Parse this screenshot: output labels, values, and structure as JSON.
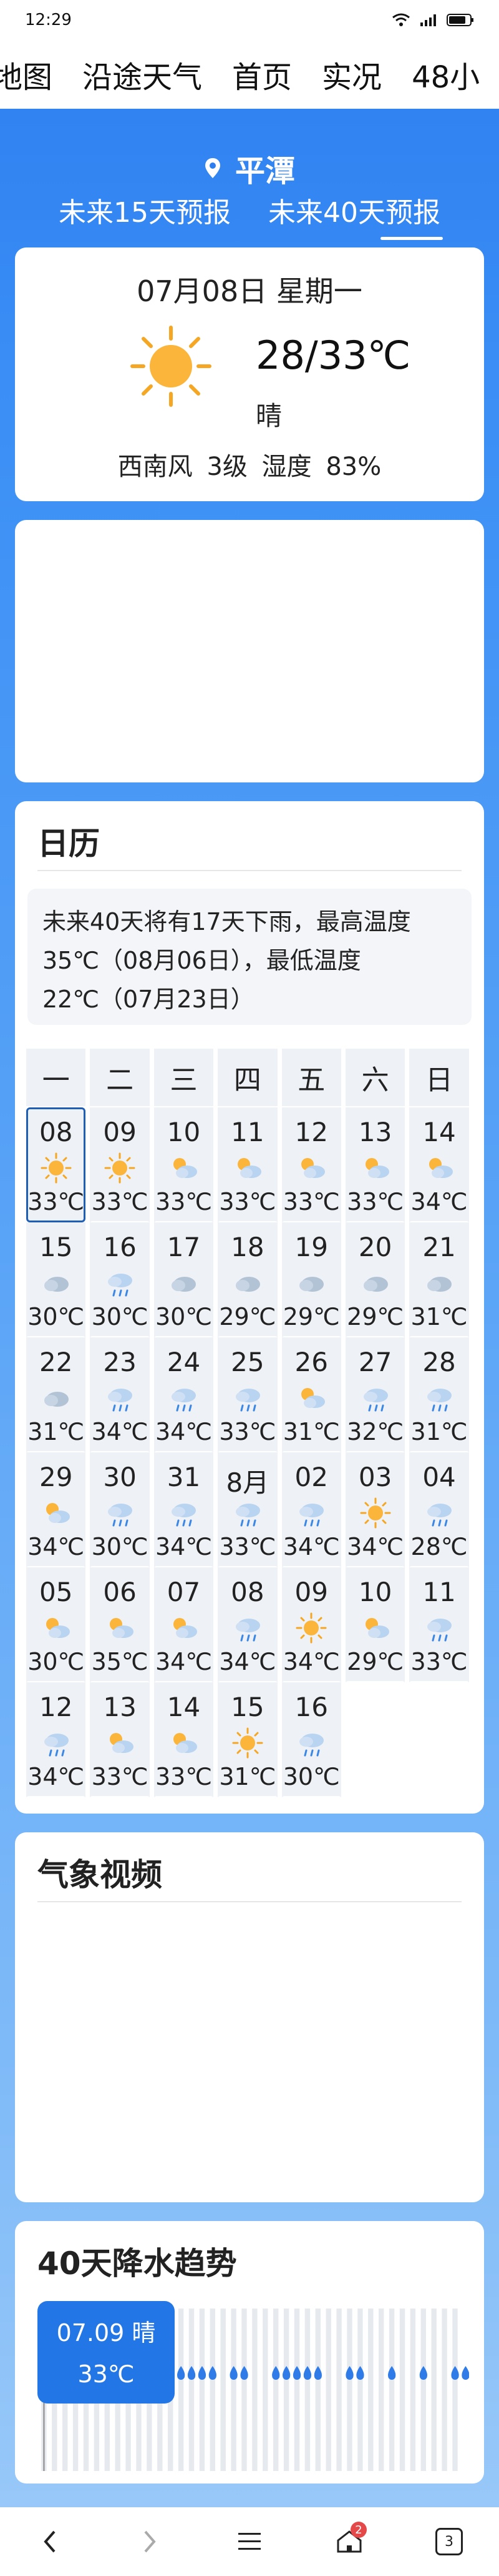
{
  "status": {
    "time": "12:29",
    "network": "4G"
  },
  "topnav": [
    "地图",
    "沿途天气",
    "首页",
    "实况",
    "48小"
  ],
  "header": {
    "city": "平潭",
    "tabs": [
      {
        "label": "未来15天预报",
        "active": false
      },
      {
        "label": "未来40天预报",
        "active": true
      }
    ]
  },
  "today": {
    "date": "07月08日 星期一",
    "temp": "28/33℃",
    "condition": "晴",
    "wind": "西南风 3级  湿度 83%",
    "icon": "sun-icon"
  },
  "calendar": {
    "title": "日历",
    "summary": "未来40天将有17天下雨，最高温度35℃（08月06日），最低温度22℃（07月23日）",
    "weekdays": [
      "一",
      "二",
      "三",
      "四",
      "五",
      "六",
      "日"
    ],
    "days": [
      {
        "d": "08",
        "icon": "sun",
        "t": "33℃",
        "selected": true
      },
      {
        "d": "09",
        "icon": "sun",
        "t": "33℃"
      },
      {
        "d": "10",
        "icon": "partly",
        "t": "33℃"
      },
      {
        "d": "11",
        "icon": "partly",
        "t": "33℃"
      },
      {
        "d": "12",
        "icon": "partly",
        "t": "33℃"
      },
      {
        "d": "13",
        "icon": "partly",
        "t": "33℃"
      },
      {
        "d": "14",
        "icon": "partly",
        "t": "34℃"
      },
      {
        "d": "15",
        "icon": "cloud",
        "t": "30℃"
      },
      {
        "d": "16",
        "icon": "rain",
        "t": "30℃"
      },
      {
        "d": "17",
        "icon": "cloud",
        "t": "30℃"
      },
      {
        "d": "18",
        "icon": "cloud",
        "t": "29℃"
      },
      {
        "d": "19",
        "icon": "cloud",
        "t": "29℃"
      },
      {
        "d": "20",
        "icon": "cloud",
        "t": "29℃"
      },
      {
        "d": "21",
        "icon": "cloud",
        "t": "31℃"
      },
      {
        "d": "22",
        "icon": "cloud",
        "t": "31℃"
      },
      {
        "d": "23",
        "icon": "rain",
        "t": "34℃"
      },
      {
        "d": "24",
        "icon": "rain",
        "t": "34℃"
      },
      {
        "d": "25",
        "icon": "rain",
        "t": "33℃"
      },
      {
        "d": "26",
        "icon": "partly",
        "t": "31℃"
      },
      {
        "d": "27",
        "icon": "rain",
        "t": "32℃"
      },
      {
        "d": "28",
        "icon": "rain",
        "t": "31℃"
      },
      {
        "d": "29",
        "icon": "partly",
        "t": "34℃"
      },
      {
        "d": "30",
        "icon": "rain",
        "t": "30℃"
      },
      {
        "d": "31",
        "icon": "rain",
        "t": "34℃"
      },
      {
        "d": "8月",
        "icon": "rain",
        "t": "33℃"
      },
      {
        "d": "02",
        "icon": "rain",
        "t": "34℃"
      },
      {
        "d": "03",
        "icon": "sun",
        "t": "34℃"
      },
      {
        "d": "04",
        "icon": "rain",
        "t": "28℃"
      },
      {
        "d": "05",
        "icon": "partly",
        "t": "30℃"
      },
      {
        "d": "06",
        "icon": "partly",
        "t": "35℃"
      },
      {
        "d": "07",
        "icon": "partly",
        "t": "34℃"
      },
      {
        "d": "08",
        "icon": "rain",
        "t": "34℃"
      },
      {
        "d": "09",
        "icon": "sun",
        "t": "34℃"
      },
      {
        "d": "10",
        "icon": "partly",
        "t": "29℃"
      },
      {
        "d": "11",
        "icon": "rain",
        "t": "33℃"
      },
      {
        "d": "12",
        "icon": "rain",
        "t": "34℃"
      },
      {
        "d": "13",
        "icon": "partly",
        "t": "33℃"
      },
      {
        "d": "14",
        "icon": "partly",
        "t": "33℃"
      },
      {
        "d": "15",
        "icon": "sun",
        "t": "31℃"
      },
      {
        "d": "16",
        "icon": "rain",
        "t": "30℃"
      }
    ]
  },
  "video": {
    "title": "气象视频"
  },
  "rain": {
    "title": "40天降水趋势",
    "tooltip_date": "07.09 晴",
    "tooltip_temp": "33℃"
  },
  "chart_data": {
    "type": "bar",
    "categories_count": 40,
    "rain_days": [
      9,
      14,
      15,
      16,
      17,
      19,
      20,
      23,
      24,
      25,
      26,
      27,
      30,
      31,
      34,
      37,
      40,
      41
    ],
    "colors": {
      "bar": "#e6e9ee",
      "rain_marker": "#2f7be8",
      "tooltip": "#2376e6"
    }
  },
  "bottombar": {
    "tabs_badge": "2",
    "tab_count": "3"
  }
}
